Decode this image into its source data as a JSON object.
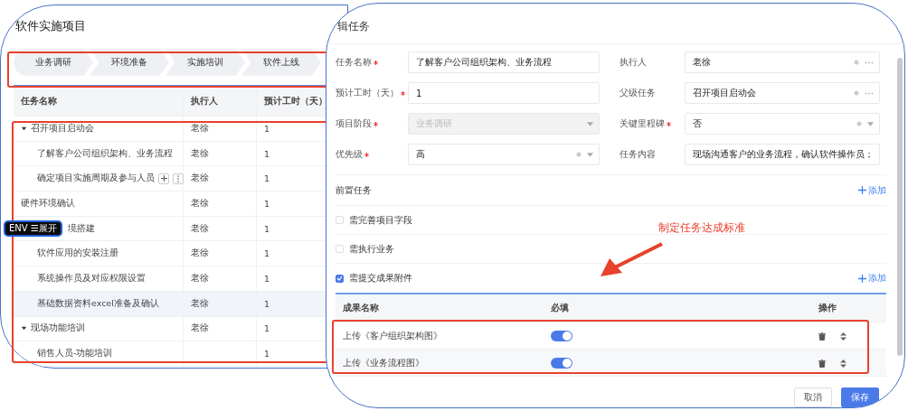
{
  "project_panel": {
    "title": "软件实施项目",
    "phases": [
      {
        "label": "业务调研"
      },
      {
        "label": "环境准备"
      },
      {
        "label": "实施培训"
      },
      {
        "label": "软件上线"
      }
    ],
    "table": {
      "columns": [
        "任务名称",
        "执行人",
        "预计工时（天）"
      ],
      "rows": [
        {
          "name": "召开项目启动会",
          "assignee": "老徐",
          "hours": "1",
          "expanded": true,
          "selected": false,
          "hovered": false,
          "children": [
            {
              "name": "了解客户公司组织架构、业务流程",
              "assignee": "老徐",
              "hours": "1",
              "selected": false,
              "hovered": false
            },
            {
              "name": "确定项目实施周期及参与人员",
              "assignee": "老徐",
              "hours": "1",
              "selected": false,
              "hovered": true
            }
          ]
        },
        {
          "name": "硬件环境确认",
          "assignee": "老徐",
          "hours": "1",
          "selected": false,
          "hovered": false
        },
        {
          "name": "境搭建",
          "badge": "ENV ☰展开",
          "assignee": "老徐",
          "hours": "1",
          "expanded": true,
          "selected": false,
          "hovered": false,
          "children": [
            {
              "name": "软件应用的安装注册",
              "assignee": "老徐",
              "hours": "1",
              "selected": false,
              "hovered": false
            },
            {
              "name": "系统操作员及对应权限设置",
              "assignee": "老徐",
              "hours": "1",
              "selected": false,
              "hovered": false
            },
            {
              "name": "基础数据资料excel准备及确认",
              "assignee": "老徐",
              "hours": "1",
              "selected": true,
              "hovered": false
            }
          ]
        },
        {
          "name": "现场功能培训",
          "assignee": "老徐",
          "hours": "1",
          "expanded": true,
          "selected": false,
          "hovered": false,
          "children": [
            {
              "name": "销售人员-功能培训",
              "hours": "1",
              "selected": false,
              "hovered": false
            }
          ]
        }
      ]
    }
  },
  "edit_dialog": {
    "title": "辑任务",
    "fields": [
      {
        "label": "任务名称",
        "required": true,
        "kind": "text",
        "value": "了解客户公司组织架构、业务流程",
        "disabled": false
      },
      {
        "label": "执行人",
        "required": false,
        "kind": "picker",
        "value": "老徐",
        "disabled": false
      },
      {
        "label": "预计工时（天）",
        "required": true,
        "kind": "text",
        "value": "1",
        "disabled": false
      },
      {
        "label": "父级任务",
        "required": false,
        "kind": "picker",
        "value": "召开项目启动会",
        "disabled": false
      },
      {
        "label": "项目阶段",
        "required": true,
        "kind": "select",
        "value": "业务调研",
        "disabled": true
      },
      {
        "label": "关键里程碑",
        "required": true,
        "kind": "select",
        "value": "否",
        "disabled": false
      },
      {
        "label": "优先级",
        "required": true,
        "kind": "select",
        "value": "高",
        "disabled": false
      },
      {
        "label": "任务内容",
        "required": false,
        "kind": "text",
        "value": "现场沟通客户的业务流程，确认软件操作员；",
        "disabled": false
      }
    ],
    "predecessor": {
      "title": "前置任务",
      "add": "添加"
    },
    "criteria": [
      {
        "label": "需完善项目字段",
        "checked": false
      },
      {
        "label": "需执行业务",
        "checked": false
      },
      {
        "label": "需提交成果附件",
        "checked": true,
        "add": "添加"
      }
    ],
    "attachments": {
      "columns": [
        "成果名称",
        "必填",
        "操作"
      ],
      "rows": [
        {
          "name": "上传《客户组织架构图》",
          "required": true
        },
        {
          "name": "上传《业务流程图》",
          "required": true
        }
      ]
    },
    "buttons": [
      {
        "label": "取消",
        "kind": "default"
      },
      {
        "label": "保存",
        "kind": "primary"
      }
    ]
  },
  "annotation": {
    "text": "制定任务达成标准"
  }
}
